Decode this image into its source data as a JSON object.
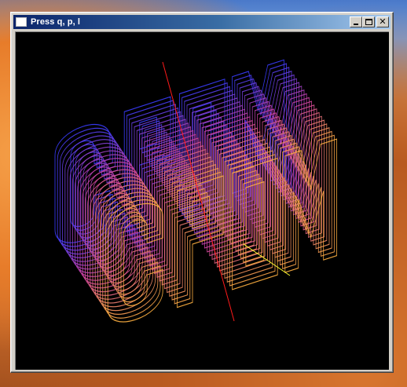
{
  "window": {
    "title": "Press q, p, l"
  },
  "titlebar_buttons": {
    "minimize_icon": "minimize-icon",
    "maximize_icon": "maximize-icon",
    "close_icon": "close-icon",
    "close_glyph": "✕"
  },
  "scene": {
    "description_icon": "3d-extruded-wireframe-text",
    "colors": {
      "background": "#000000",
      "axis_red": "#ff1a1a",
      "axis_yellow": "#ffff30",
      "wire_blue": "#3a3cff",
      "wire_magenta": "#d040a0",
      "wire_orange": "#ffb040"
    }
  }
}
